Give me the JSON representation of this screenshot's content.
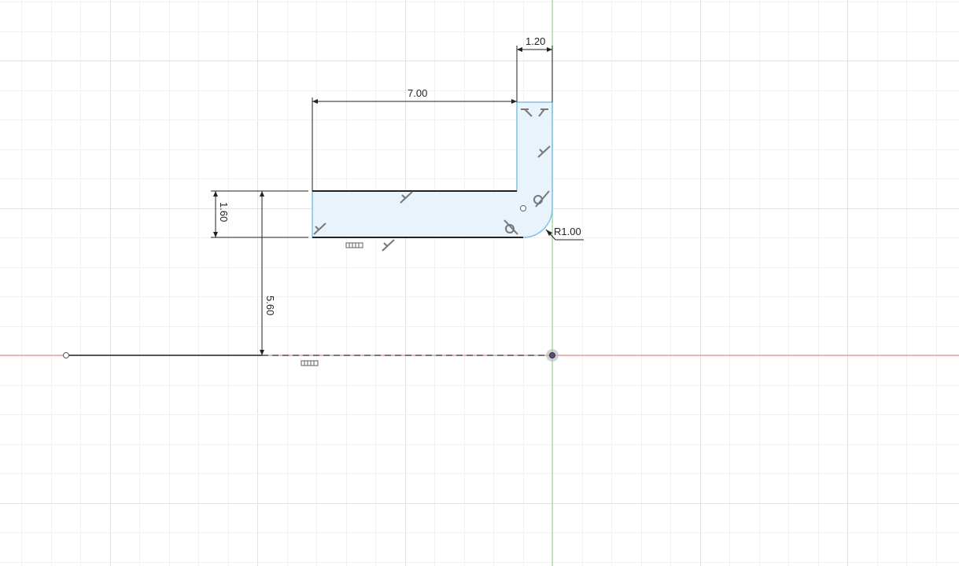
{
  "app": {
    "view": "sketch-canvas"
  },
  "colors": {
    "background": "#ffffff",
    "grid_minor": "#f1f1f1",
    "grid_major": "#e2e2e2",
    "x_axis": "#e87a7a",
    "y_axis": "#8fd48f",
    "profile_fill": "#e8f3fb",
    "profile_edge": "#7cc3e6",
    "sketch_line": "#222222",
    "dimension": "#222222",
    "constraint_glyph": "#777777"
  },
  "sketch": {
    "dimensions": {
      "width_top": "1.20",
      "length": "7.00",
      "height": "1.60",
      "offset": "5.60",
      "radius": "R1.00"
    },
    "constraints": [
      "perpendicular-icon",
      "tangent-icon",
      "coincident-icon",
      "horizontal-icon",
      "midpoint-icon"
    ]
  }
}
